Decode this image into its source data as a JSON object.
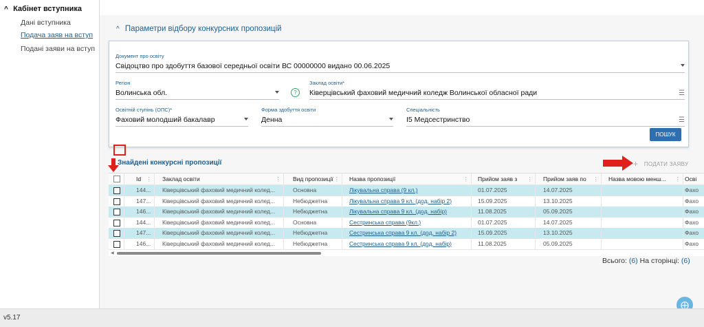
{
  "sidebar": {
    "title": "Кабінет вступника",
    "items": [
      {
        "label": "Дані вступника"
      },
      {
        "label": "Подача заяв на вступ"
      },
      {
        "label": "Подані заяви на вступ"
      }
    ]
  },
  "footer": {
    "version": "v5.17"
  },
  "filters": {
    "section_title": "Параметри відбору конкурсних пропозицій",
    "document": {
      "label": "Документ про освіту",
      "value": "Свідоцтво про здобуття базової середньої освіти ВС 00000000 видано 00.06.2025"
    },
    "region": {
      "label": "Регіон",
      "value": "Волинська обл."
    },
    "institution": {
      "label": "Заклад освіти*",
      "value": "Ківерцівський фаховий медичний коледж Волинської обласної ради"
    },
    "degree": {
      "label": "Освітній ступінь (ОПС)*",
      "value": "Фаховий молодший бакалавр"
    },
    "study_form": {
      "label": "Форма здобуття освіти",
      "value": "Денна"
    },
    "specialty": {
      "label": "Спеціальність",
      "value": "І5 Медсестринство"
    },
    "help_icon": "?",
    "search_button": "ПОШУК"
  },
  "results": {
    "title": "Знайдені конкурсні пропозиції",
    "submit_button": "ПОДАТИ ЗАЯВУ",
    "columns": [
      "Id",
      "Заклад освіти",
      "Вид пропозиції",
      "Назва пропозиції",
      "Прийом заяв з",
      "Прийом заяв по",
      "Назва мовою менш...",
      "Осві"
    ],
    "rows": [
      {
        "id": "144...",
        "inst": "Ківерцівський фаховий медичний колед...",
        "kind": "Основна",
        "name": "Лікувальна справа (9 кл.)",
        "from": "01.07.2025",
        "to": "14.07.2025",
        "minor": "",
        "edu": "Фахо",
        "highlight": true
      },
      {
        "id": "147...",
        "inst": "Ківерцівський фаховий медичний колед...",
        "kind": "Небюджетна",
        "name": "Лікувальна справа 9 кл. (дод. набір 2)",
        "from": "15.09.2025",
        "to": "13.10.2025",
        "minor": "",
        "edu": "Фахо",
        "highlight": false
      },
      {
        "id": "146...",
        "inst": "Ківерцівський фаховий медичний колед...",
        "kind": "Небюджетна",
        "name": "Лікувальна справа 9 кл. (дод. набір)",
        "from": "11.08.2025",
        "to": "05.09.2025",
        "minor": "",
        "edu": "Фахо",
        "highlight": true
      },
      {
        "id": "144...",
        "inst": "Ківерцівський фаховий медичний колед...",
        "kind": "Основна",
        "name": "Сестринська справа (9кл.)",
        "from": "01.07.2025",
        "to": "14.07.2025",
        "minor": "",
        "edu": "Фахо",
        "highlight": false
      },
      {
        "id": "147...",
        "inst": "Ківерцівський фаховий медичний колед...",
        "kind": "Небюджетна",
        "name": "Сестринська справа 9 кл. (дод. набір 2)",
        "from": "15.09.2025",
        "to": "13.10.2025",
        "minor": "",
        "edu": "Фахо",
        "highlight": true
      },
      {
        "id": "146...",
        "inst": "Ківерцівський фаховий медичний колед...",
        "kind": "Небюджетна",
        "name": "Сестринська справа 9 кл. (дод. набір)",
        "from": "11.08.2025",
        "to": "05.09.2025",
        "minor": "",
        "edu": "Фахо",
        "highlight": false
      }
    ],
    "totals_label": "Всього:",
    "totals_count": "(6)",
    "per_page_label": "На сторінці:",
    "per_page_count": "(6)"
  },
  "colors": {
    "accent": "#1f5e8c",
    "highlight_row": "#c7eaf0",
    "annotation": "#e0201a",
    "button": "#2f6faf"
  }
}
